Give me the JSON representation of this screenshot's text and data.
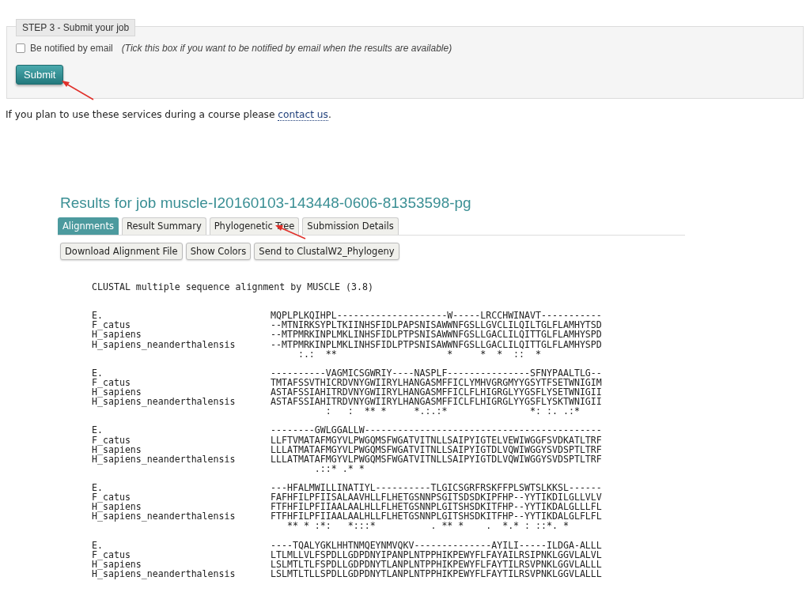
{
  "step": {
    "legend": "STEP 3 - Submit your job",
    "notify": {
      "label": "Be notified by email",
      "hint": "(Tick this box if you want to be notified by email when the results are available)",
      "checked": false
    },
    "submit": "Submit"
  },
  "course_note": {
    "text": "If you plan to use these services during a course please ",
    "link": "contact us",
    "after": "."
  },
  "results": {
    "title": "Results for job muscle-I20160103-143448-0606-81353598-pg",
    "tabs": [
      {
        "label": "Alignments",
        "selected": true
      },
      {
        "label": "Result Summary",
        "selected": false
      },
      {
        "label": "Phylogenetic Tree",
        "selected": false
      },
      {
        "label": "Submission Details",
        "selected": false
      }
    ],
    "actions": [
      "Download Alignment File",
      "Show Colors",
      "Send to ClustalW2_Phylogeny"
    ],
    "alignment": {
      "header": "CLUSTAL multiple sequence alignment by MUSCLE (3.8)",
      "blocks": [
        {
          "rows": [
            {
              "name": "E.",
              "seq": "MQPLPLKQIHPL--------------------W-----LRCCHWINAVT-----------"
            },
            {
              "name": "F_catus",
              "seq": "--MTNIRKSYPLTKIINHSFIDLPAPSNISAWWNFGSLLGVCLILQILTGLFLAMHYTSD"
            },
            {
              "name": "H_sapiens",
              "seq": "--MTPMRKINPLMKLINHSFIDLPTPSNISAWWNFGSLLGACLILQITTGLFLAMHYSPD"
            },
            {
              "name": "H_sapiens_neanderthalensis",
              "seq": "--MTPMRKINPLMKLINHSFIDLPTPSNISAWWNFGSLLGACLILQITTGLFLAMHYSPD"
            }
          ],
          "consensus": "     :.:  **                    *     *  *  ::  *"
        },
        {
          "rows": [
            {
              "name": "E.",
              "seq": "----------VAGMICSGWRIY----NASPLF---------------SFNYPAALTLG--"
            },
            {
              "name": "F_catus",
              "seq": "TMTAFSSVTHICRDVNYGWIIRYLHANGASMFFICLYMHVGRGMYYGSYTFSETWNIGIM"
            },
            {
              "name": "H_sapiens",
              "seq": "ASTAFSSIAHITRDVNYGWIIRYLHANGASMFFICLFLHIGRGLYYGSFLYSETWNIGII"
            },
            {
              "name": "H_sapiens_neanderthalensis",
              "seq": "ASTAFSSIAHITRDVNYGWIIRYLHANGASMFFICLFLHIGRGLYYGSFLYSKTWNIGII"
            }
          ],
          "consensus": "          :   :  ** *     *.:.:*               *: :. .:*"
        },
        {
          "rows": [
            {
              "name": "E.",
              "seq": "--------GWLGGALLW-------------------------------------------"
            },
            {
              "name": "F_catus",
              "seq": "LLFTVMATAFMGYVLPWGQMSFWGATVITNLLSAIPYIGTELVEWIWGGFSVDKATLTRF"
            },
            {
              "name": "H_sapiens",
              "seq": "LLLATMATAFMGYVLPWGQMSFWGATVITNLLSAIPYIGTDLVQWIWGGYSVDSPTLTRF"
            },
            {
              "name": "H_sapiens_neanderthalensis",
              "seq": "LLLATMATAFMGYVLPWGQMSFWGATVITNLLSAIPYIGTDLVQWIWGGYSVDSPTLTRF"
            }
          ],
          "consensus": "        .::* .* *"
        },
        {
          "rows": [
            {
              "name": "E.",
              "seq": "---HFALMWILLINATIYL----------TLGICSGRFRSKFFPLSWTSLKKSL------"
            },
            {
              "name": "F_catus",
              "seq": "FAFHFILPFIISALAAVHLLFLHETGSNNPSGITSDSDKIPFHP--YYTIKDILGLLVLV"
            },
            {
              "name": "H_sapiens",
              "seq": "FTFHFILPFIIAALAALHLLFLHETGSNNPLGITSHSDKITFHP--YYTIKDALGLLLFL"
            },
            {
              "name": "H_sapiens_neanderthalensis",
              "seq": "FTFHFILPFIIAALAALHLLFLHETGSNNPLGITSHSDKITFHP--YYTIKDALGLFLFL"
            }
          ],
          "consensus": "   ** * :*:   *:::*          . ** *    .  *.* : ::*. *"
        },
        {
          "rows": [
            {
              "name": "E.",
              "seq": "----TQALYGKLHHTNMQEYNMVQKV--------------AYILI-----ILDGA-ALLL"
            },
            {
              "name": "F_catus",
              "seq": "LTLMLLVLFSPDLLGDPDNYIPANPLNTPPHIKPEWYFLFAYAILRSIPNKLGGVLALVL"
            },
            {
              "name": "H_sapiens",
              "seq": "LSLMTLTLFSPDLLGDPDNYTLANPLNTPPHIKPEWYFLFAYTILRSVPNKLGGVLALLL"
            },
            {
              "name": "H_sapiens_neanderthalensis",
              "seq": "LSLMTLTLLSPDLLGDPDNYTLANPLNTPPHIKPEWYFLFAYTILRSVPNKLGGVLALLL"
            }
          ]
        }
      ]
    }
  }
}
